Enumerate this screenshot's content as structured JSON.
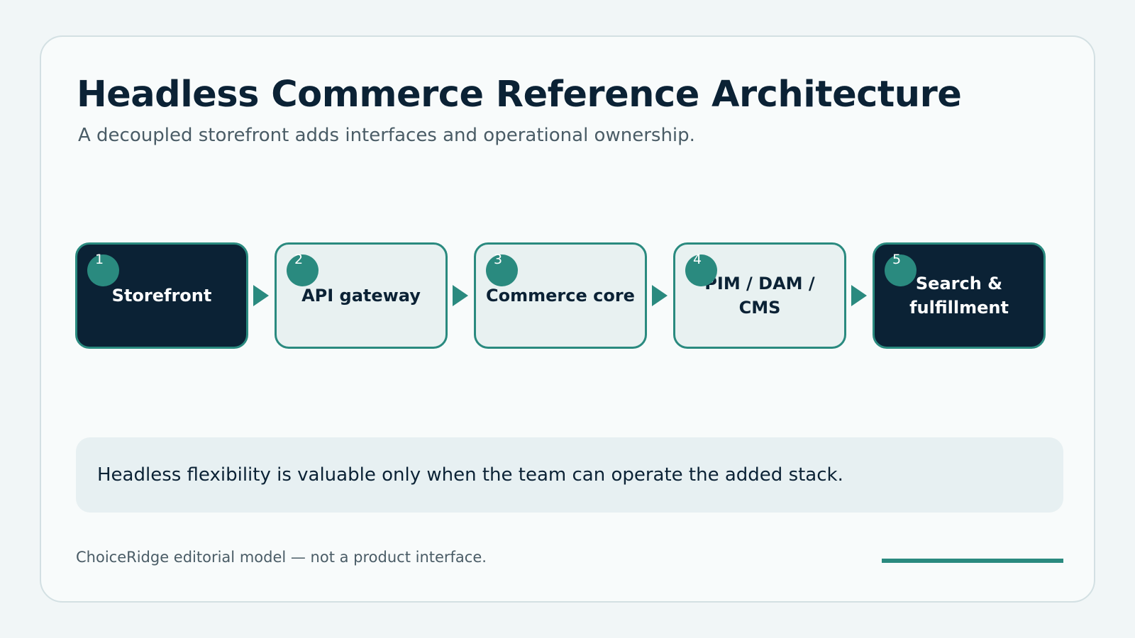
{
  "title": "Headless Commerce Reference Architecture",
  "subtitle": "A decoupled storefront adds interfaces and operational ownership.",
  "nodes": [
    {
      "number": "1",
      "label": "Storefront",
      "style": "dark"
    },
    {
      "number": "2",
      "label": "API gateway",
      "style": "light"
    },
    {
      "number": "3",
      "label": "Commerce core",
      "style": "light"
    },
    {
      "number": "4",
      "label": "PIM / DAM / CMS",
      "style": "light"
    },
    {
      "number": "5",
      "label": "Search & fulfillment",
      "style": "dark"
    }
  ],
  "callout": "Headless flexibility is valuable only when the team can operate the added stack.",
  "footer": "ChoiceRidge editorial model — not a product interface.",
  "colors": {
    "accent": "#2a8a7f",
    "dark": "#0b2235",
    "light_fill": "#e8f1f1",
    "callout_bg": "#e7f0f2"
  }
}
